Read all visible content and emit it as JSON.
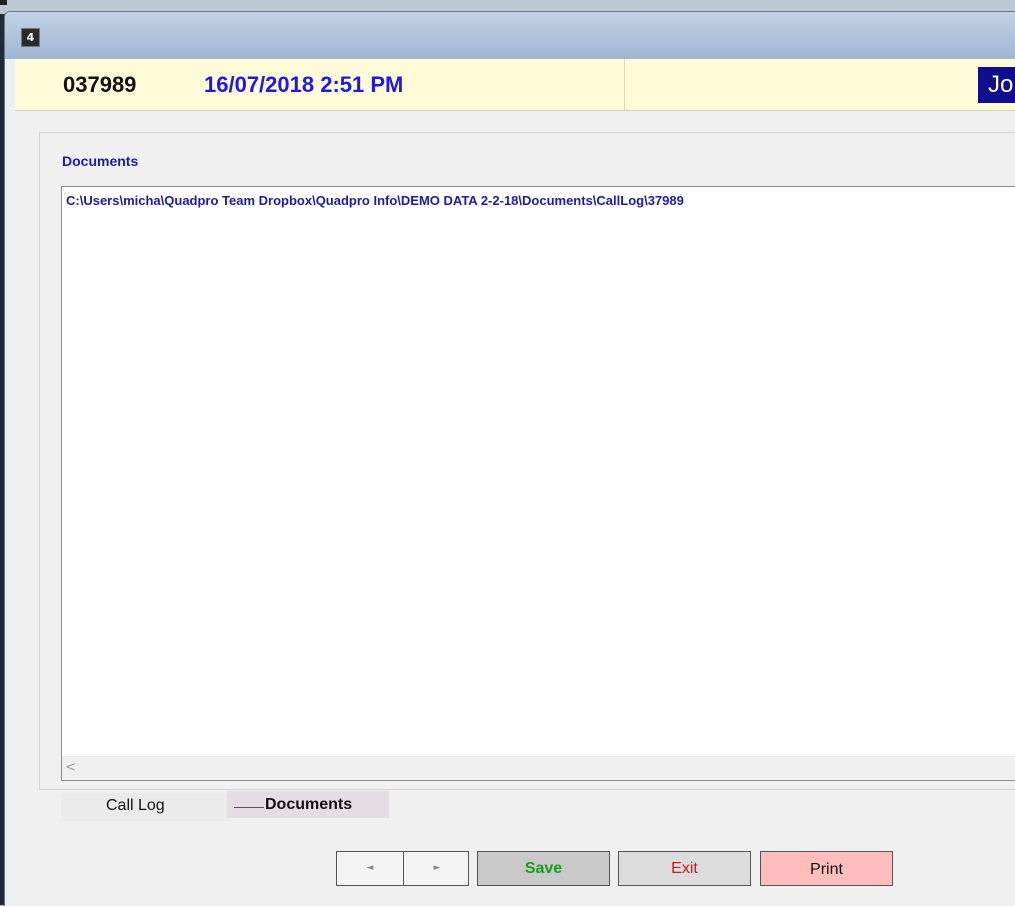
{
  "header": {
    "record_number": "037989",
    "datetime": "16/07/2018  2:51 PM",
    "badge": "Jo"
  },
  "panel": {
    "section_label": "Documents",
    "document_path": "C:\\Users\\micha\\Quadpro Team Dropbox\\Quadpro Info\\DEMO DATA 2-2-18\\Documents\\CallLog\\37989"
  },
  "tabs": [
    {
      "label": "Call Log",
      "active": false
    },
    {
      "label": "Documents",
      "active": true
    }
  ],
  "buttons": {
    "prev": "◄",
    "next": "►",
    "save": "Save",
    "exit": "Exit",
    "print": "Print"
  },
  "icons": {
    "app": "4d-app-icon",
    "scroll_left": "chevron-left-icon"
  },
  "colors": {
    "header_bg": "#fffbd8",
    "accent_blue": "#1a1aef",
    "label_blue": "#1b1bb0",
    "badge_bg": "#0e0e8e",
    "save_text": "#1b9b1b",
    "exit_text": "#d91414",
    "print_bg": "#ffbdbd"
  }
}
